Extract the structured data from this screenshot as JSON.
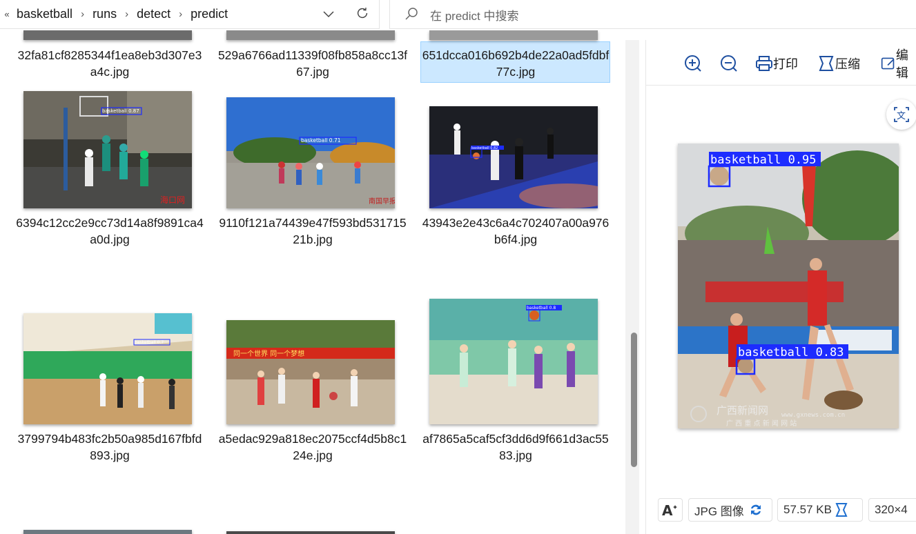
{
  "breadcrumb": {
    "overflow": "«",
    "items": [
      "basketball",
      "runs",
      "detect",
      "predict"
    ],
    "separator": "›"
  },
  "search": {
    "placeholder": "在 predict 中搜索"
  },
  "files": [
    {
      "name": "32fa81cf8285344f1ea8eb3d307e3a4c.jpg",
      "selected": false
    },
    {
      "name": "529a6766ad11339f08fb858a8cc13f67.jpg",
      "selected": false
    },
    {
      "name": "651dcca016b692b4de22a0ad5fdbf77c.jpg",
      "selected": true
    },
    {
      "name": "6394c12cc2e9cc73d14a8f9891ca4a0d.jpg",
      "label": "basketball 0.87",
      "watermark": "海口网"
    },
    {
      "name": "9110f121a74439e47f593bd53171521b.jpg",
      "label": "basketball 0.71",
      "watermark": "南国早报"
    },
    {
      "name": "43943e2e43c6a4c702407a00a976b6f4.jpg",
      "label": "basketball 0.82"
    },
    {
      "name": "3799794b483fc2b50a985d167fbfd893.jpg",
      "label": "basketball 0.7"
    },
    {
      "name": "a5edac929a818ec2075ccf4d5b8c124e.jpg",
      "banner": "同一个世界 同一个梦想"
    },
    {
      "name": "af7865a5caf5cf3dd6d9f661d3ac5583.jpg",
      "label": "basketball 0.8"
    }
  ],
  "viewer": {
    "tools": {
      "zoom_in": "zoom-in",
      "zoom_out": "zoom-out",
      "print": "打印",
      "compress": "压缩",
      "edit": "编辑"
    },
    "image": {
      "det1": "basketball 0.95",
      "det2": "basketball 0.83",
      "watermark_title": "广西新闻网",
      "watermark_url": "www.gxnews.com.cn",
      "watermark_sub": "广 西 重 点 新 闻 网 站"
    },
    "status": {
      "format": "JPG 图像",
      "size": "57.57 KB",
      "dims": "320×4"
    }
  },
  "colors": {
    "accent_blue": "#0000ff",
    "selection_bg": "#cce8ff",
    "icon_blue": "#1e4fa0"
  }
}
